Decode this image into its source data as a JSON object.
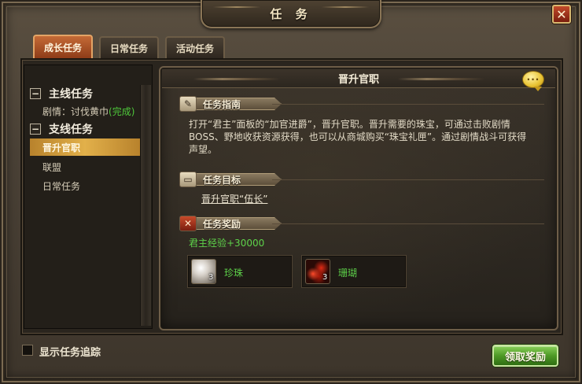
{
  "window": {
    "title": "任 务",
    "close_label": "✕"
  },
  "tabs": [
    {
      "label": "成长任务",
      "active": true
    },
    {
      "label": "日常任务",
      "active": false
    },
    {
      "label": "活动任务",
      "active": false
    }
  ],
  "tree": {
    "main_group": {
      "label": "主线任务",
      "toggle": "−"
    },
    "main_quest": {
      "prefix": "剧情：讨伐黄巾",
      "status": "(完成)"
    },
    "branch_group": {
      "label": "支线任务",
      "toggle": "−"
    },
    "items": [
      {
        "label": "晋升官职",
        "selected": true
      },
      {
        "label": "联盟",
        "selected": false
      },
      {
        "label": "日常任务",
        "selected": false
      }
    ]
  },
  "detail": {
    "title": "晋升官职",
    "chat_icon_text": "···",
    "guide": {
      "label": "任务指南",
      "text": "打开“君主”面板的“加官进爵”，晋升官职。晋升需要的珠宝，可通过击败剧情BOSS、野地收获资源获得，也可以从商城购买“珠宝礼匣”。通过剧情战斗可获得声望。"
    },
    "goal": {
      "label": "任务目标",
      "text": "晋升官职“伍长”"
    },
    "reward": {
      "label": "任务奖励",
      "exp_text": "君主经验+30000",
      "items": [
        {
          "name": "珍珠",
          "count": "3",
          "icon": "pearl-icon"
        },
        {
          "name": "珊瑚",
          "count": "3",
          "icon": "coral-icon"
        }
      ]
    }
  },
  "footer": {
    "track_label": "显示任务追踪",
    "claim_label": "领取奖励"
  },
  "colors": {
    "accent_green": "#5ed24a",
    "tab_active": "#c46a36",
    "selected_item": "#e2b04a"
  }
}
